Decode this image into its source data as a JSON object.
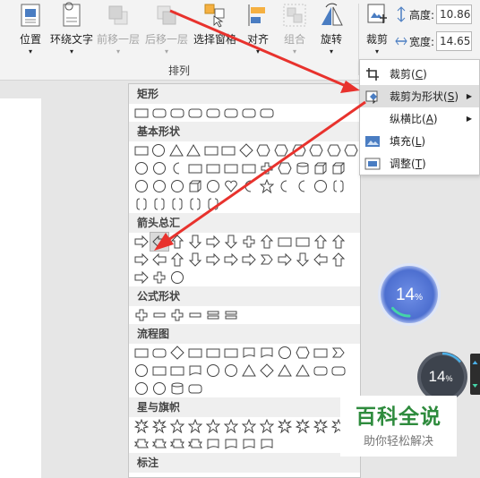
{
  "ribbon": {
    "buttons": [
      {
        "label": "位置",
        "icon": "position-icon",
        "disabled": false
      },
      {
        "label": "环绕文字",
        "icon": "wrap-text-icon",
        "disabled": false
      },
      {
        "label": "前移一层",
        "icon": "bring-forward-icon",
        "disabled": true
      },
      {
        "label": "后移一层",
        "icon": "send-backward-icon",
        "disabled": true
      },
      {
        "label": "选择窗格",
        "icon": "selection-pane-icon",
        "disabled": false
      },
      {
        "label": "对齐",
        "icon": "align-icon",
        "disabled": false
      },
      {
        "label": "组合",
        "icon": "group-icon",
        "disabled": true
      },
      {
        "label": "旋转",
        "icon": "rotate-icon",
        "disabled": false
      }
    ],
    "group_label": "排列",
    "crop_button": {
      "label": "裁剪",
      "icon": "crop-icon"
    },
    "height": {
      "label": "高度:",
      "value": "10.86 "
    },
    "width": {
      "label": "宽度:",
      "value": "14.65 "
    }
  },
  "crop_menu": {
    "items": [
      {
        "label": "裁剪",
        "key": "C",
        "icon": "crop-icon",
        "highlighted": false,
        "submenu": false
      },
      {
        "label": "裁剪为形状",
        "key": "S",
        "icon": "crop-to-shape-icon",
        "highlighted": true,
        "submenu": true
      },
      {
        "label": "纵横比",
        "key": "A",
        "icon": "",
        "highlighted": false,
        "submenu": true
      },
      {
        "label": "填充",
        "key": "L",
        "icon": "fill-icon",
        "highlighted": false,
        "submenu": false
      },
      {
        "label": "调整",
        "key": "T",
        "icon": "fit-icon",
        "highlighted": false,
        "submenu": false
      }
    ]
  },
  "gallery": {
    "sections": [
      {
        "title": "矩形",
        "rows": [
          [
            "rect",
            "round-rect",
            "snip1",
            "snip2",
            "snip-round",
            "round1",
            "round2",
            "round-diag"
          ]
        ]
      },
      {
        "title": "基本形状",
        "rows": [
          [
            "textbox",
            "oval",
            "triangle",
            "rt-triangle",
            "parallelogram",
            "trapezoid",
            "diamond",
            "pentagon",
            "hexagon",
            "heptagon",
            "octagon",
            "decagon",
            "dodecagon"
          ],
          [
            "pie",
            "chord",
            "teardrop",
            "frame",
            "half-frame",
            "l-shape",
            "diag-stripe",
            "cross",
            "plaque",
            "can",
            "cube",
            "bevel"
          ],
          [
            "donut",
            "no-symbol",
            "block-arc",
            "folded-corner",
            "smiley",
            "heart",
            "lightning",
            "sun",
            "moon",
            "cloud",
            "arc",
            "bracket-pair"
          ],
          [
            "brace-pair",
            "left-bracket",
            "right-bracket",
            "left-brace",
            "right-brace"
          ]
        ]
      },
      {
        "title": "箭头总汇",
        "rows": [
          [
            "right-arrow",
            "left-arrow",
            "up-arrow",
            "down-arrow",
            "left-right-arrow",
            "up-down-arrow",
            "quad-arrow",
            "left-right-up-arrow",
            "bent-arrow",
            "u-turn-arrow",
            "left-up-arrow",
            "bent-up-arrow"
          ],
          [
            "curved-right",
            "curved-left",
            "curved-up",
            "curved-down",
            "striped-right",
            "notched-right",
            "pentagon-arrow",
            "chevron",
            "right-callout",
            "down-callout",
            "left-callout",
            "up-callout"
          ],
          [
            "left-right-callout",
            "quad-callout",
            "circular-arrow"
          ]
        ]
      },
      {
        "title": "公式形状",
        "rows": [
          [
            "plus",
            "minus",
            "multiply",
            "divide",
            "equal",
            "not-equal"
          ]
        ]
      },
      {
        "title": "流程图",
        "rows": [
          [
            "process",
            "alt-process",
            "decision",
            "data",
            "predefined",
            "internal-storage",
            "document",
            "multidoc",
            "terminator",
            "preparation",
            "manual-input",
            "manual-op"
          ],
          [
            "connector",
            "offpage",
            "card",
            "punched-tape",
            "summing",
            "or",
            "collate",
            "sort",
            "extract",
            "merge",
            "stored-data",
            "delay"
          ],
          [
            "seq-storage",
            "magnetic-disk",
            "direct-storage",
            "display"
          ]
        ]
      },
      {
        "title": "星与旗帜",
        "rows": [
          [
            "explosion1",
            "explosion2",
            "star4",
            "star5",
            "star6",
            "star7",
            "star8",
            "star10",
            "star12",
            "star16",
            "star24",
            "star32"
          ],
          [
            "ribbon-up",
            "ribbon-down",
            "curved-ribbon-up",
            "curved-ribbon-down",
            "scroll-v",
            "scroll-h",
            "wave",
            "double-wave"
          ]
        ]
      },
      {
        "title": "标注",
        "rows": []
      }
    ]
  },
  "widgets": {
    "gauge_large": {
      "value": "14",
      "unit": "%"
    },
    "gauge_small": {
      "value": "14",
      "unit": "%"
    }
  },
  "watermark": {
    "title": "百科全说",
    "subtitle": "助你轻松解决"
  },
  "colors": {
    "accent_red": "#e8322d",
    "gauge_blue": "#4d6fd0",
    "gauge_green": "#45d4a8",
    "watermark_green": "#2e8b3d"
  }
}
